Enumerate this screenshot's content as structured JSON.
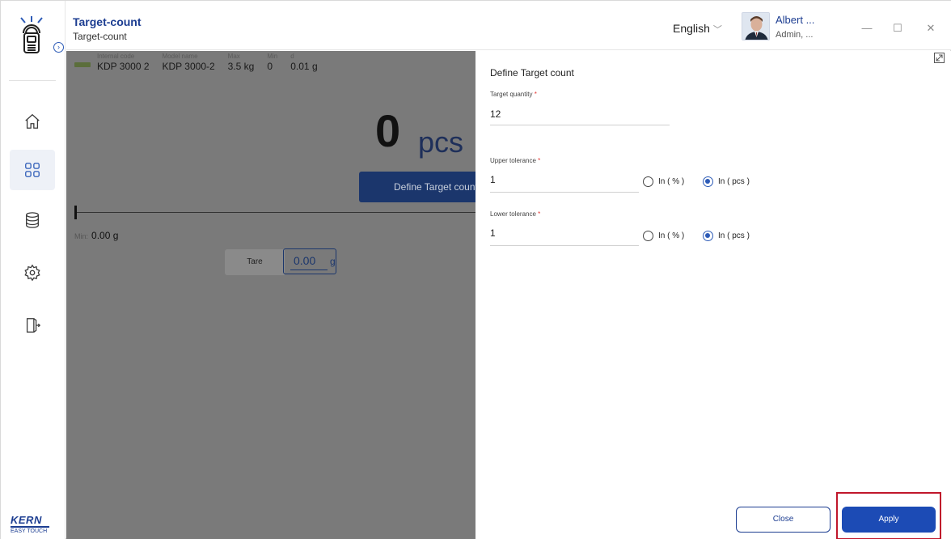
{
  "app": {
    "title": "Target-count",
    "subtitle": "Target-count",
    "language": "English",
    "user_name": "Albert ...",
    "user_role": "Admin, ...",
    "brand": "KERN",
    "brand_sub": "EASY TOUCH"
  },
  "window_controls": {
    "minimize": "—",
    "maximize": "☐",
    "close": "✕"
  },
  "sidebar": {
    "items": [
      {
        "name": "home",
        "icon": "home-icon"
      },
      {
        "name": "apps",
        "icon": "grid-icon",
        "active": true
      },
      {
        "name": "database",
        "icon": "database-icon"
      },
      {
        "name": "settings",
        "icon": "gear-icon"
      },
      {
        "name": "logout",
        "icon": "logout-icon"
      }
    ]
  },
  "scale_info": [
    {
      "label": "Internal code",
      "value": "KDP 3000 2"
    },
    {
      "label": "Model name",
      "value": "KDP 3000-2"
    },
    {
      "label": "Max",
      "value": "3.5 kg"
    },
    {
      "label": "Min",
      "value": "0"
    },
    {
      "label": "d",
      "value": "0.01 g"
    }
  ],
  "main": {
    "count_value": "0",
    "count_unit": "pcs",
    "define_button": "Define Target count",
    "min_label": "Min:",
    "min_value": "0.00 g",
    "tare_button": "Tare",
    "tare_value": "0.00",
    "tare_unit": "g"
  },
  "panel": {
    "title": "Define Target count",
    "target_quantity": {
      "label": "Target quantity",
      "value": "12"
    },
    "upper_tolerance": {
      "label": "Upper tolerance",
      "value": "1",
      "option_percent": "In ( % )",
      "option_pcs": "In ( pcs )",
      "selected": "pcs"
    },
    "lower_tolerance": {
      "label": "Lower tolerance",
      "value": "1",
      "option_percent": "In ( % )",
      "option_pcs": "In ( pcs )",
      "selected": "pcs"
    },
    "required_mark": "*",
    "close_button": "Close",
    "apply_button": "Apply"
  },
  "colors": {
    "brand": "#1c3d91",
    "accent": "#1c4bb5",
    "overlay": "#7a7a7a",
    "highlight": "#c0172b"
  }
}
